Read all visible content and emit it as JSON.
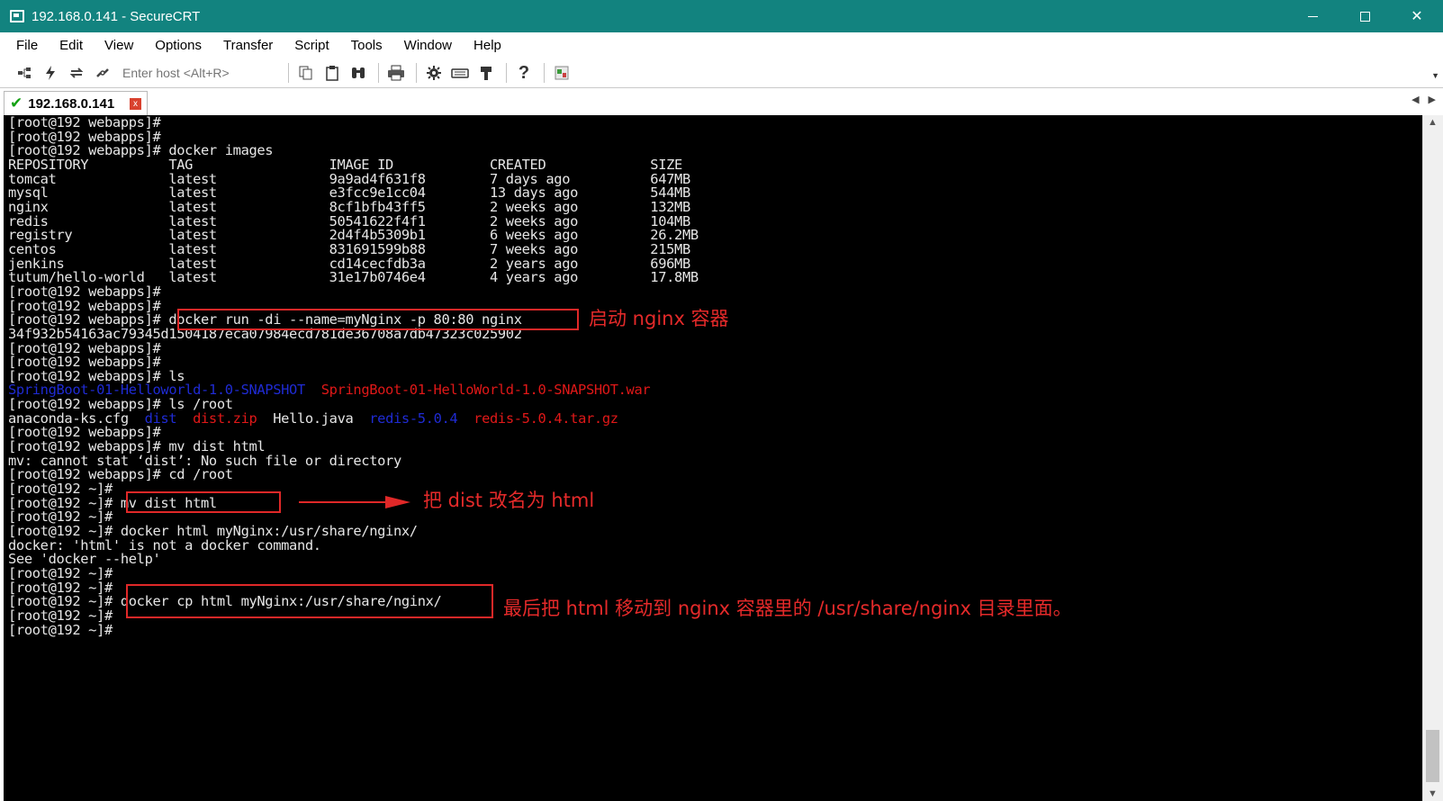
{
  "window": {
    "title": "192.168.0.141 - SecureCRT"
  },
  "window_controls": {
    "minimize": "minimize",
    "maximize": "maximize",
    "close": "✕"
  },
  "menu": [
    "File",
    "Edit",
    "View",
    "Options",
    "Transfer",
    "Script",
    "Tools",
    "Window",
    "Help"
  ],
  "toolbar": {
    "host_placeholder": "Enter host <Alt+R>",
    "icons": [
      "connect-icon",
      "quick-connect-icon",
      "reconnect-icon",
      "disconnect-icon",
      "copy-icon",
      "paste-icon",
      "find-icon",
      "print-icon",
      "settings-icon",
      "keymap-icon",
      "sftp-icon",
      "help-icon",
      "about-icon"
    ]
  },
  "tab": {
    "label": "192.168.0.141",
    "close": "x"
  },
  "terminal": {
    "lines": [
      [
        {
          "t": "[root@192 webapps]#"
        }
      ],
      [
        {
          "t": "[root@192 webapps]#"
        }
      ],
      [
        {
          "t": "[root@192 webapps]# docker images"
        }
      ],
      [
        {
          "t": "REPOSITORY          TAG                 IMAGE ID            CREATED             SIZE"
        }
      ],
      [
        {
          "t": "tomcat              latest              9a9ad4f631f8        7 days ago          647MB"
        }
      ],
      [
        {
          "t": "mysql               latest              e3fcc9e1cc04        13 days ago         544MB"
        }
      ],
      [
        {
          "t": "nginx               latest              8cf1bfb43ff5        2 weeks ago         132MB"
        }
      ],
      [
        {
          "t": "redis               latest              50541622f4f1        2 weeks ago         104MB"
        }
      ],
      [
        {
          "t": "registry            latest              2d4f4b5309b1        6 weeks ago         26.2MB"
        }
      ],
      [
        {
          "t": "centos              latest              831691599b88        7 weeks ago         215MB"
        }
      ],
      [
        {
          "t": "jenkins             latest              cd14cecfdb3a        2 years ago         696MB"
        }
      ],
      [
        {
          "t": "tutum/hello-world   latest              31e17b0746e4        4 years ago         17.8MB"
        }
      ],
      [
        {
          "t": "[root@192 webapps]#"
        }
      ],
      [
        {
          "t": "[root@192 webapps]#"
        }
      ],
      [
        {
          "t": "[root@192 webapps]# docker run -di --name=myNginx -p 80:80 nginx"
        }
      ],
      [
        {
          "t": "34f932b54163ac79345d1504187eca07984ecd781de36708a7db47323c025902"
        }
      ],
      [
        {
          "t": "[root@192 webapps]#"
        }
      ],
      [
        {
          "t": "[root@192 webapps]#"
        }
      ],
      [
        {
          "t": "[root@192 webapps]# ls"
        }
      ],
      [
        {
          "t": "SpringBoot-01-Helloworld-1.0-SNAPSHOT",
          "c": "blue"
        },
        {
          "t": "  "
        },
        {
          "t": "SpringBoot-01-HelloWorld-1.0-SNAPSHOT.war",
          "c": "red"
        }
      ],
      [
        {
          "t": "[root@192 webapps]# ls /root"
        }
      ],
      [
        {
          "t": "anaconda-ks.cfg  "
        },
        {
          "t": "dist",
          "c": "blue"
        },
        {
          "t": "  "
        },
        {
          "t": "dist.zip",
          "c": "red"
        },
        {
          "t": "  Hello.java  "
        },
        {
          "t": "redis-5.0.4",
          "c": "blue"
        },
        {
          "t": "  "
        },
        {
          "t": "redis-5.0.4.tar.gz",
          "c": "red"
        }
      ],
      [
        {
          "t": "[root@192 webapps]#"
        }
      ],
      [
        {
          "t": "[root@192 webapps]# mv dist html"
        }
      ],
      [
        {
          "t": "mv: cannot stat ‘dist’: No such file or directory"
        }
      ],
      [
        {
          "t": "[root@192 webapps]# cd /root"
        }
      ],
      [
        {
          "t": "[root@192 ~]#"
        }
      ],
      [
        {
          "t": "[root@192 ~]# mv dist html"
        }
      ],
      [
        {
          "t": "[root@192 ~]#"
        }
      ],
      [
        {
          "t": "[root@192 ~]# docker html myNginx:/usr/share/nginx/"
        }
      ],
      [
        {
          "t": "docker: 'html' is not a docker command."
        }
      ],
      [
        {
          "t": "See 'docker --help'"
        }
      ],
      [
        {
          "t": "[root@192 ~]#"
        }
      ],
      [
        {
          "t": "[root@192 ~]#"
        }
      ],
      [
        {
          "t": "[root@192 ~]# docker cp html myNginx:/usr/share/nginx/"
        }
      ],
      [
        {
          "t": "[root@192 ~]#"
        }
      ],
      [
        {
          "t": "[root@192 ~]#"
        }
      ]
    ]
  },
  "annotations": {
    "start_nginx": "启动 nginx 容器",
    "rename_dist": "把 dist 改名为 html",
    "move_html": "最后把 html 移动到 nginx 容器里的 /usr/share/nginx 目录里面。"
  }
}
